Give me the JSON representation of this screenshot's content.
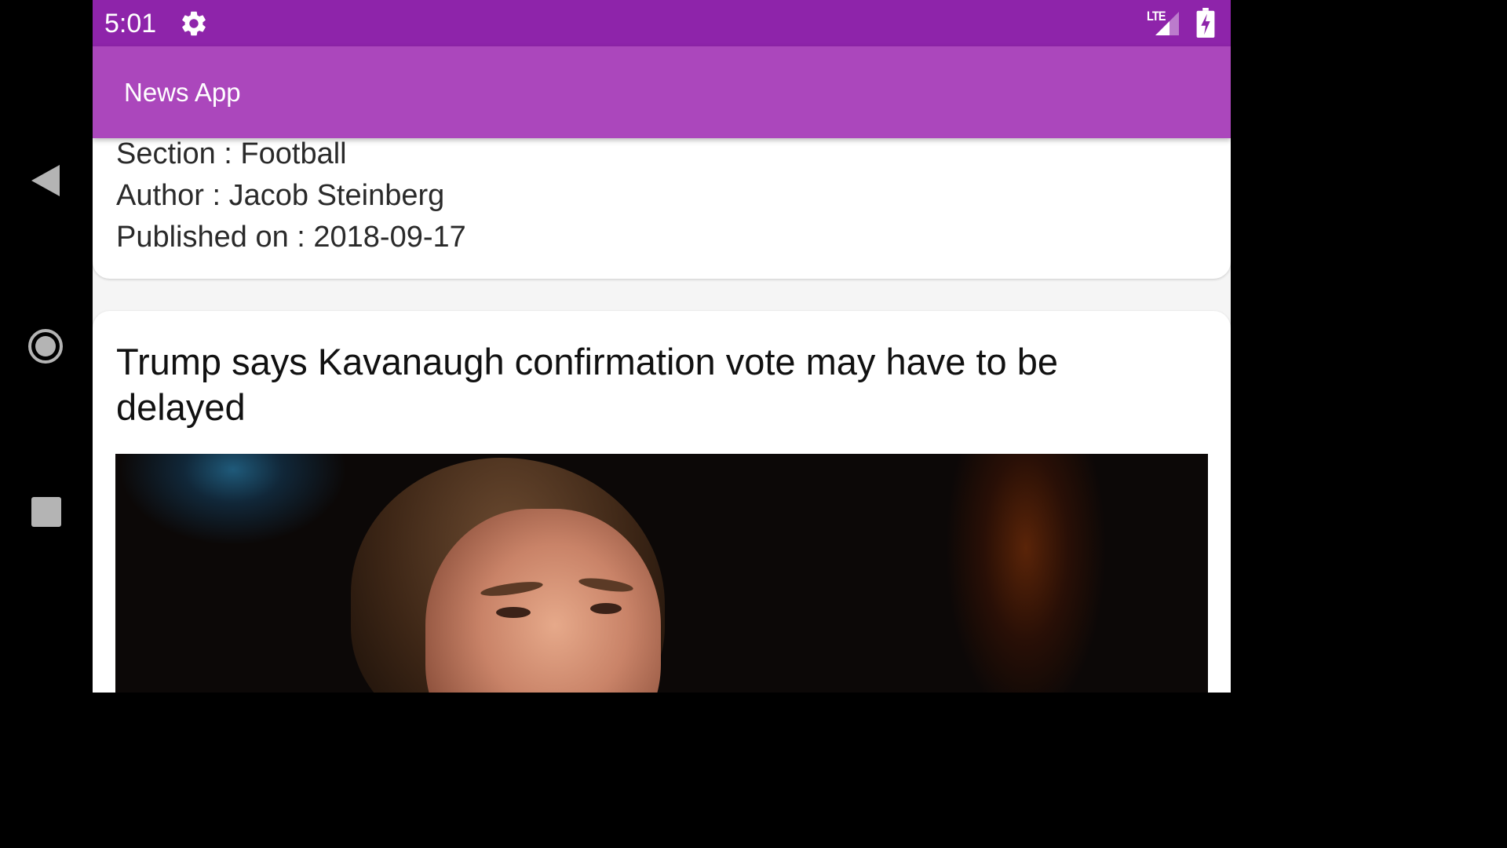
{
  "status_bar": {
    "time": "5:01",
    "network": "LTE"
  },
  "app_bar": {
    "title": "News App"
  },
  "articles": [
    {
      "section": "Section : Football",
      "author": "Author : Jacob Steinberg",
      "published": "Published on : 2018-09-17"
    },
    {
      "title": "Trump says Kavanaugh confirmation vote may have to be delayed"
    }
  ],
  "icons": {
    "settings": "gear-icon",
    "signal": "signal-icon",
    "battery": "battery-charging-icon",
    "back": "back-icon",
    "home": "home-icon",
    "recents": "recents-icon"
  },
  "colors": {
    "status_bar": "#8e24aa",
    "app_bar": "#ab47bc",
    "background": "#f5f5f5"
  }
}
